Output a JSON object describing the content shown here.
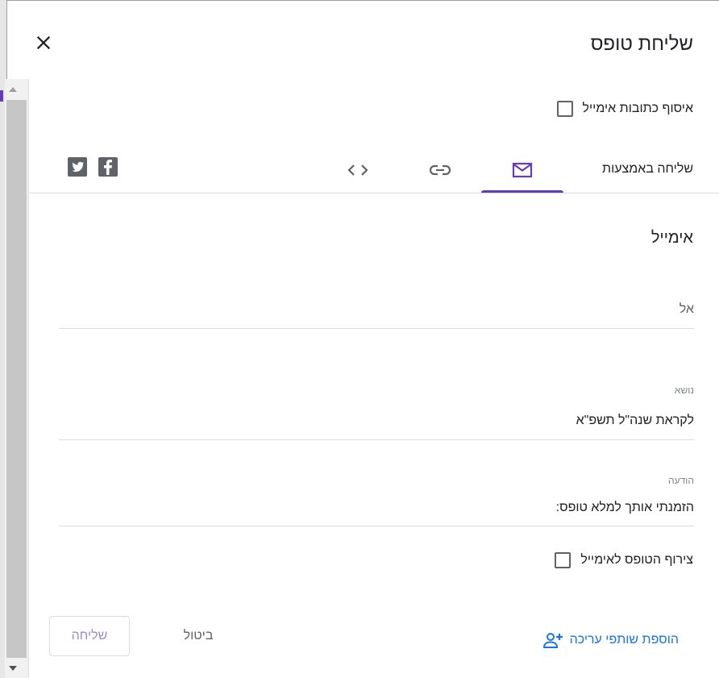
{
  "dialog": {
    "title": "שליחת טופס",
    "collect_emails_label": "איסוף כתובות אימייל",
    "send_via_label": "שליחה באמצעות"
  },
  "tabs": [
    {
      "id": "email",
      "icon": "mail-icon",
      "selected": true
    },
    {
      "id": "link",
      "icon": "link-icon",
      "selected": false
    },
    {
      "id": "embed",
      "icon": "code-icon",
      "selected": false
    }
  ],
  "social": [
    {
      "icon": "facebook-icon"
    },
    {
      "icon": "twitter-icon"
    }
  ],
  "email_form": {
    "section_title": "אימייל",
    "to_placeholder": "אל",
    "subject_label": "נושא",
    "subject_value": "לקראת שנה\"ל תשפ\"א",
    "message_label": "הודעה",
    "message_value": "הזמנתי אותך למלא טופס:",
    "attach_form_label": "צירוף הטופס לאימייל"
  },
  "footer": {
    "add_editors_label": "הוספת שותפי עריכה",
    "cancel_label": "ביטול",
    "send_label": "שליחה"
  },
  "colors": {
    "accent": "#673ab7",
    "link": "#1a73e8",
    "text": "#202124",
    "muted": "#5f6368"
  }
}
